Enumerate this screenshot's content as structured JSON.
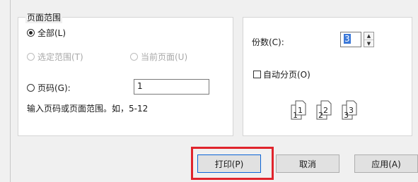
{
  "page_range": {
    "legend": "页面范围",
    "all_label": "全部(L)",
    "selection_label": "选定范围(T)",
    "current_page_label": "当前页面(U)",
    "pages_label": "页码(G):",
    "pages_value": "1",
    "hint": "输入页码或页面范围。如，5-12"
  },
  "copies": {
    "label": "份数(C):",
    "value": "3",
    "collate_label": "自动分页(O)",
    "collate_icon": "collate-pages-icon",
    "collate_numbers": [
      "1",
      "1",
      "2",
      "2",
      "3",
      "3"
    ]
  },
  "buttons": {
    "print": "打印(P)",
    "cancel": "取消",
    "apply": "应用(A)"
  },
  "colors": {
    "highlight": "#e0242c",
    "focus_border": "#0a64d6",
    "selection": "#3b78d8"
  }
}
